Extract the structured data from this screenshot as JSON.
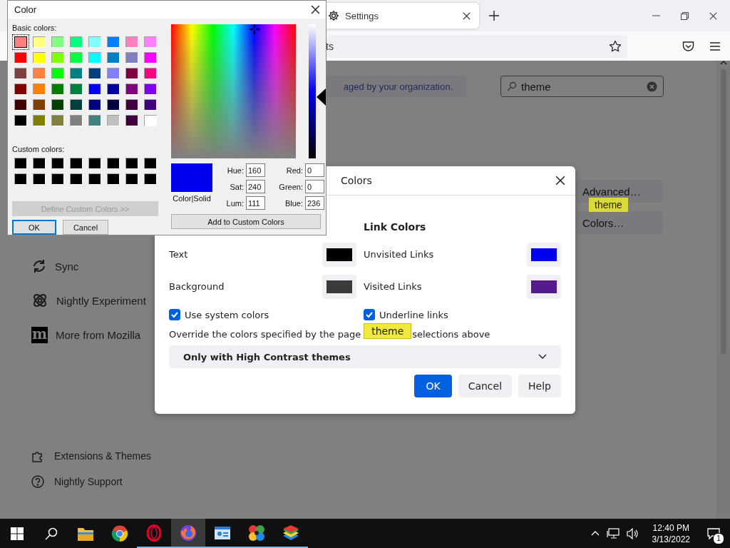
{
  "browser": {
    "tab": {
      "title": "Settings"
    },
    "address_fragment": "ts",
    "notice": "aged by your organization.",
    "search": {
      "value": "theme"
    },
    "buttons": [
      {
        "label": "Advanced…"
      },
      {
        "label": "Colors…"
      }
    ],
    "tooltip": "theme",
    "sidebar": [
      {
        "label": "Sync",
        "kind": "sync"
      },
      {
        "label": "Nightly Experiment",
        "kind": "experiments"
      },
      {
        "label": "More from Mozilla",
        "kind": "mozilla",
        "logo": "m"
      }
    ],
    "footer": [
      {
        "label": "Extensions & Themes",
        "kind": "extensions"
      },
      {
        "label": "Nightly Support",
        "kind": "support"
      }
    ]
  },
  "colors_dialog": {
    "title": "Colors",
    "link_heading": "Link Colors",
    "rows": [
      {
        "label": "Text",
        "color": "#000000"
      },
      {
        "label": "Unvisited Links",
        "color": "#0000ee"
      },
      {
        "label": "Background",
        "color": "#3b3b3b"
      },
      {
        "label": "Visited Links",
        "color": "#551a8b"
      }
    ],
    "checks": [
      {
        "label": "Use system colors",
        "checked": true
      },
      {
        "label": "Underline links",
        "checked": true
      }
    ],
    "override_start": "Override the colors specified by the page",
    "override_end": "selections above",
    "tooltip": "theme",
    "select": "Only with High Contrast themes",
    "buttons": [
      {
        "label": "OK",
        "kind": "primary"
      },
      {
        "label": "Cancel",
        "kind": "normal"
      },
      {
        "label": "Help",
        "kind": "normal"
      }
    ]
  },
  "color_dialog": {
    "title": "Color",
    "basic_label": "Basic colors:",
    "basic_colors": [
      {
        "color": "#ff8080",
        "selected": true
      },
      {
        "color": "#ffff80",
        "selected": false
      },
      {
        "color": "#80ff80",
        "selected": false
      },
      {
        "color": "#00ff80",
        "selected": false
      },
      {
        "color": "#80ffff",
        "selected": false
      },
      {
        "color": "#0080ff",
        "selected": false
      },
      {
        "color": "#ff80c0",
        "selected": false
      },
      {
        "color": "#ff80ff",
        "selected": false
      },
      {
        "color": "#ff0000",
        "selected": false
      },
      {
        "color": "#ffff00",
        "selected": false
      },
      {
        "color": "#80ff00",
        "selected": false
      },
      {
        "color": "#00ff40",
        "selected": false
      },
      {
        "color": "#00ffff",
        "selected": false
      },
      {
        "color": "#0080c0",
        "selected": false
      },
      {
        "color": "#8080c0",
        "selected": false
      },
      {
        "color": "#ff00ff",
        "selected": false
      },
      {
        "color": "#804040",
        "selected": false
      },
      {
        "color": "#ff8040",
        "selected": false
      },
      {
        "color": "#00ff00",
        "selected": false
      },
      {
        "color": "#008080",
        "selected": false
      },
      {
        "color": "#004080",
        "selected": false
      },
      {
        "color": "#8080ff",
        "selected": false
      },
      {
        "color": "#800040",
        "selected": false
      },
      {
        "color": "#ff0080",
        "selected": false
      },
      {
        "color": "#800000",
        "selected": false
      },
      {
        "color": "#ff8000",
        "selected": false
      },
      {
        "color": "#008000",
        "selected": false
      },
      {
        "color": "#008040",
        "selected": false
      },
      {
        "color": "#0000ff",
        "selected": false
      },
      {
        "color": "#0000a0",
        "selected": false
      },
      {
        "color": "#800080",
        "selected": false
      },
      {
        "color": "#8000ff",
        "selected": false
      },
      {
        "color": "#400000",
        "selected": false
      },
      {
        "color": "#804000",
        "selected": false
      },
      {
        "color": "#004000",
        "selected": false
      },
      {
        "color": "#004040",
        "selected": false
      },
      {
        "color": "#000080",
        "selected": false
      },
      {
        "color": "#000040",
        "selected": false
      },
      {
        "color": "#400040",
        "selected": false
      },
      {
        "color": "#400080",
        "selected": false
      },
      {
        "color": "#000000",
        "selected": false
      },
      {
        "color": "#808000",
        "selected": false
      },
      {
        "color": "#808040",
        "selected": false
      },
      {
        "color": "#808080",
        "selected": false
      },
      {
        "color": "#408080",
        "selected": false
      },
      {
        "color": "#c0c0c0",
        "selected": false
      },
      {
        "color": "#400040",
        "selected": false
      },
      {
        "color": "#ffffff",
        "selected": false
      }
    ],
    "custom_label": "Custom colors:",
    "custom_colors": [
      {
        "color": "#000000"
      },
      {
        "color": "#000000"
      },
      {
        "color": "#000000"
      },
      {
        "color": "#000000"
      },
      {
        "color": "#000000"
      },
      {
        "color": "#000000"
      },
      {
        "color": "#000000"
      },
      {
        "color": "#000000"
      },
      {
        "color": "#000000"
      },
      {
        "color": "#000000"
      },
      {
        "color": "#000000"
      },
      {
        "color": "#000000"
      },
      {
        "color": "#000000"
      },
      {
        "color": "#000000"
      },
      {
        "color": "#000000"
      },
      {
        "color": "#000000"
      }
    ],
    "define_button": {
      "label": "Define Custom Colors >>",
      "disabled": true
    },
    "ok": "OK",
    "cancel": "Cancel",
    "lum_slider": {
      "level": 0.46
    },
    "preview_label": "Color|Solid",
    "fields": [
      {
        "label": "Hue:",
        "value": "160"
      },
      {
        "label": "Red:",
        "value": "0"
      },
      {
        "label": "Sat:",
        "value": "240"
      },
      {
        "label": "Green:",
        "value": "0"
      },
      {
        "label": "Lum:",
        "value": "111"
      },
      {
        "label": "Blue:",
        "value": "236"
      }
    ],
    "add_button": "Add to Custom Colors"
  },
  "taskbar": {
    "apps": [
      {
        "kind": "explorer",
        "selected": false,
        "running": false
      },
      {
        "kind": "chrome",
        "selected": false,
        "running": false
      },
      {
        "kind": "opera",
        "selected": false,
        "running": true
      },
      {
        "kind": "firefox",
        "selected": true,
        "running": true
      },
      {
        "kind": "card",
        "selected": false,
        "running": true
      },
      {
        "kind": "petal",
        "selected": false,
        "running": true
      },
      {
        "kind": "layers",
        "selected": false,
        "running": true
      }
    ],
    "time": "12:40 PM",
    "date": "3/13/2022",
    "notification_count": "1"
  }
}
